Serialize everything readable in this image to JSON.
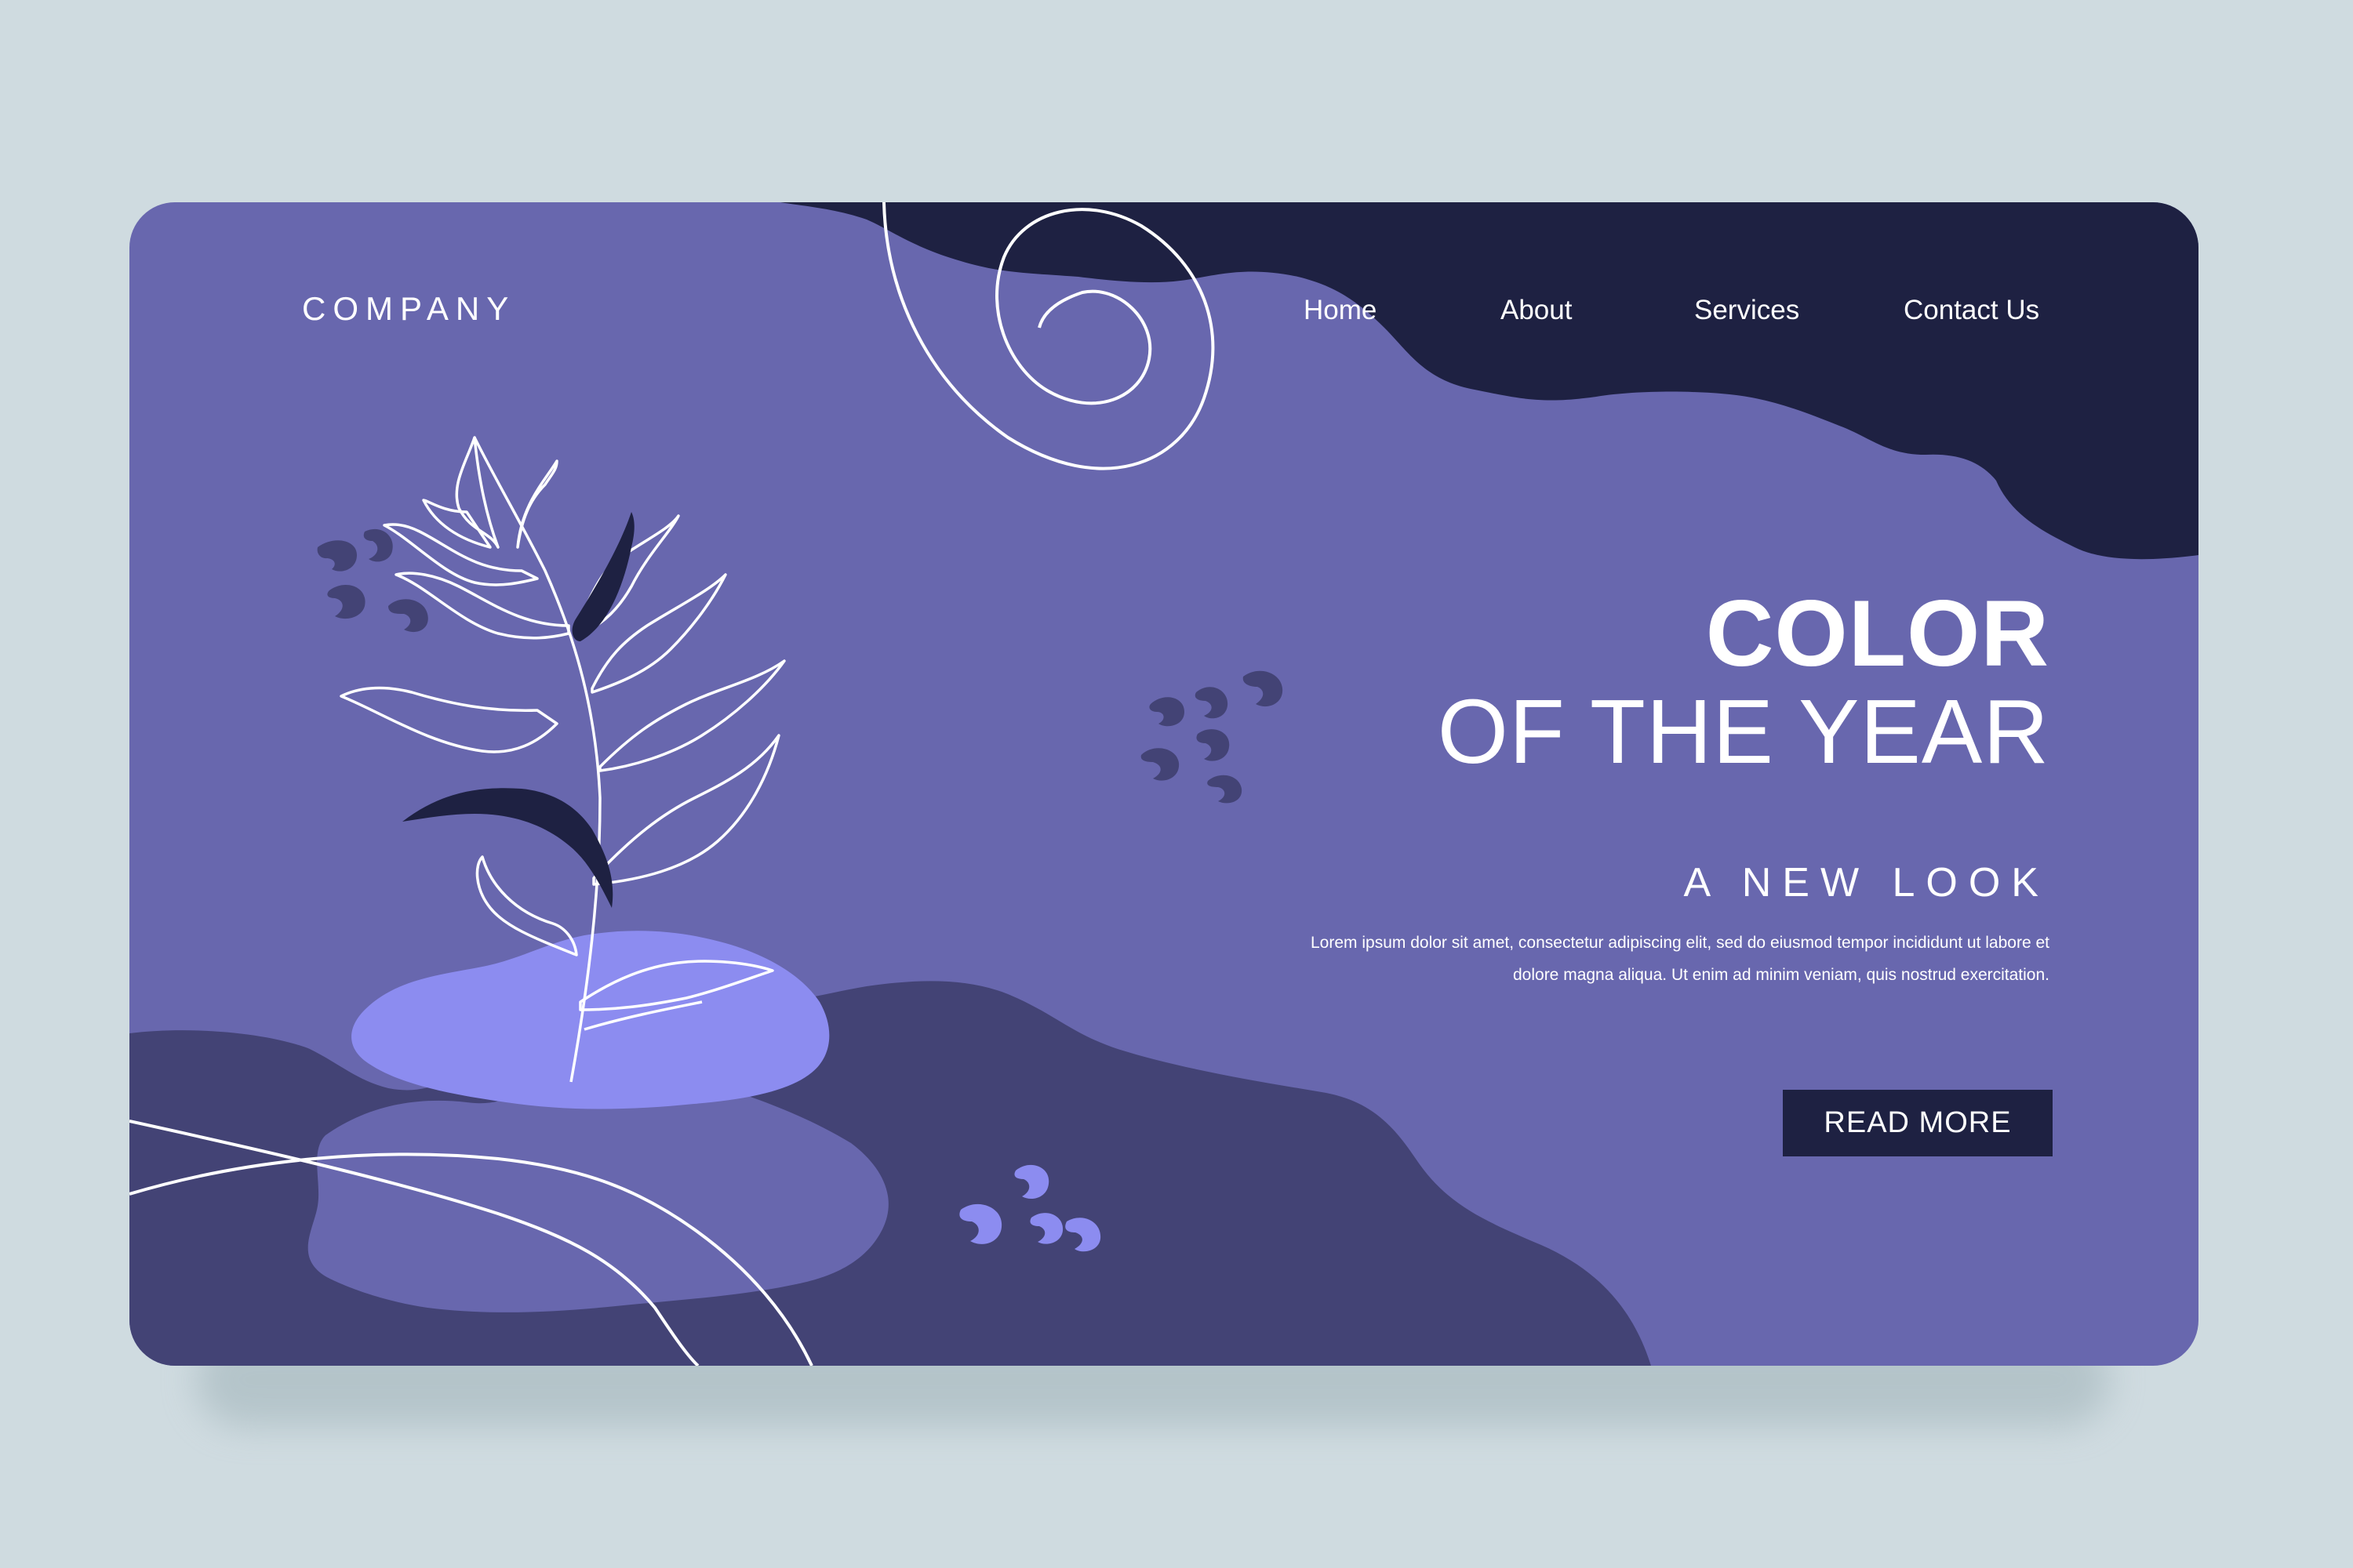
{
  "brand": {
    "logo_text": "COMPANY"
  },
  "nav": {
    "items": [
      {
        "label": "Home"
      },
      {
        "label": "About"
      },
      {
        "label": "Services"
      },
      {
        "label": "Contact Us"
      }
    ]
  },
  "hero": {
    "headline_bold": "COLOR",
    "headline_light": "OF THE YEAR",
    "subheading": "A NEW LOOK",
    "body": "Lorem ipsum dolor sit amet, consectetur adipiscing elit, sed do eiusmod tempor incididunt ut labore et dolore magna aliqua. Ut enim ad minim veniam, quis nostrud exercitation.",
    "cta_label": "READ MORE"
  },
  "colors": {
    "page_background": "#cfdbe0",
    "primary_purple": "#6867ae",
    "navy": "#1e2142",
    "dark_purple": "#434375",
    "light_lavender": "#8c8cf0",
    "text": "#ffffff"
  },
  "icons": [
    "spiral-line-art",
    "leaf-branch-illustration",
    "abstract-dot-cluster"
  ]
}
